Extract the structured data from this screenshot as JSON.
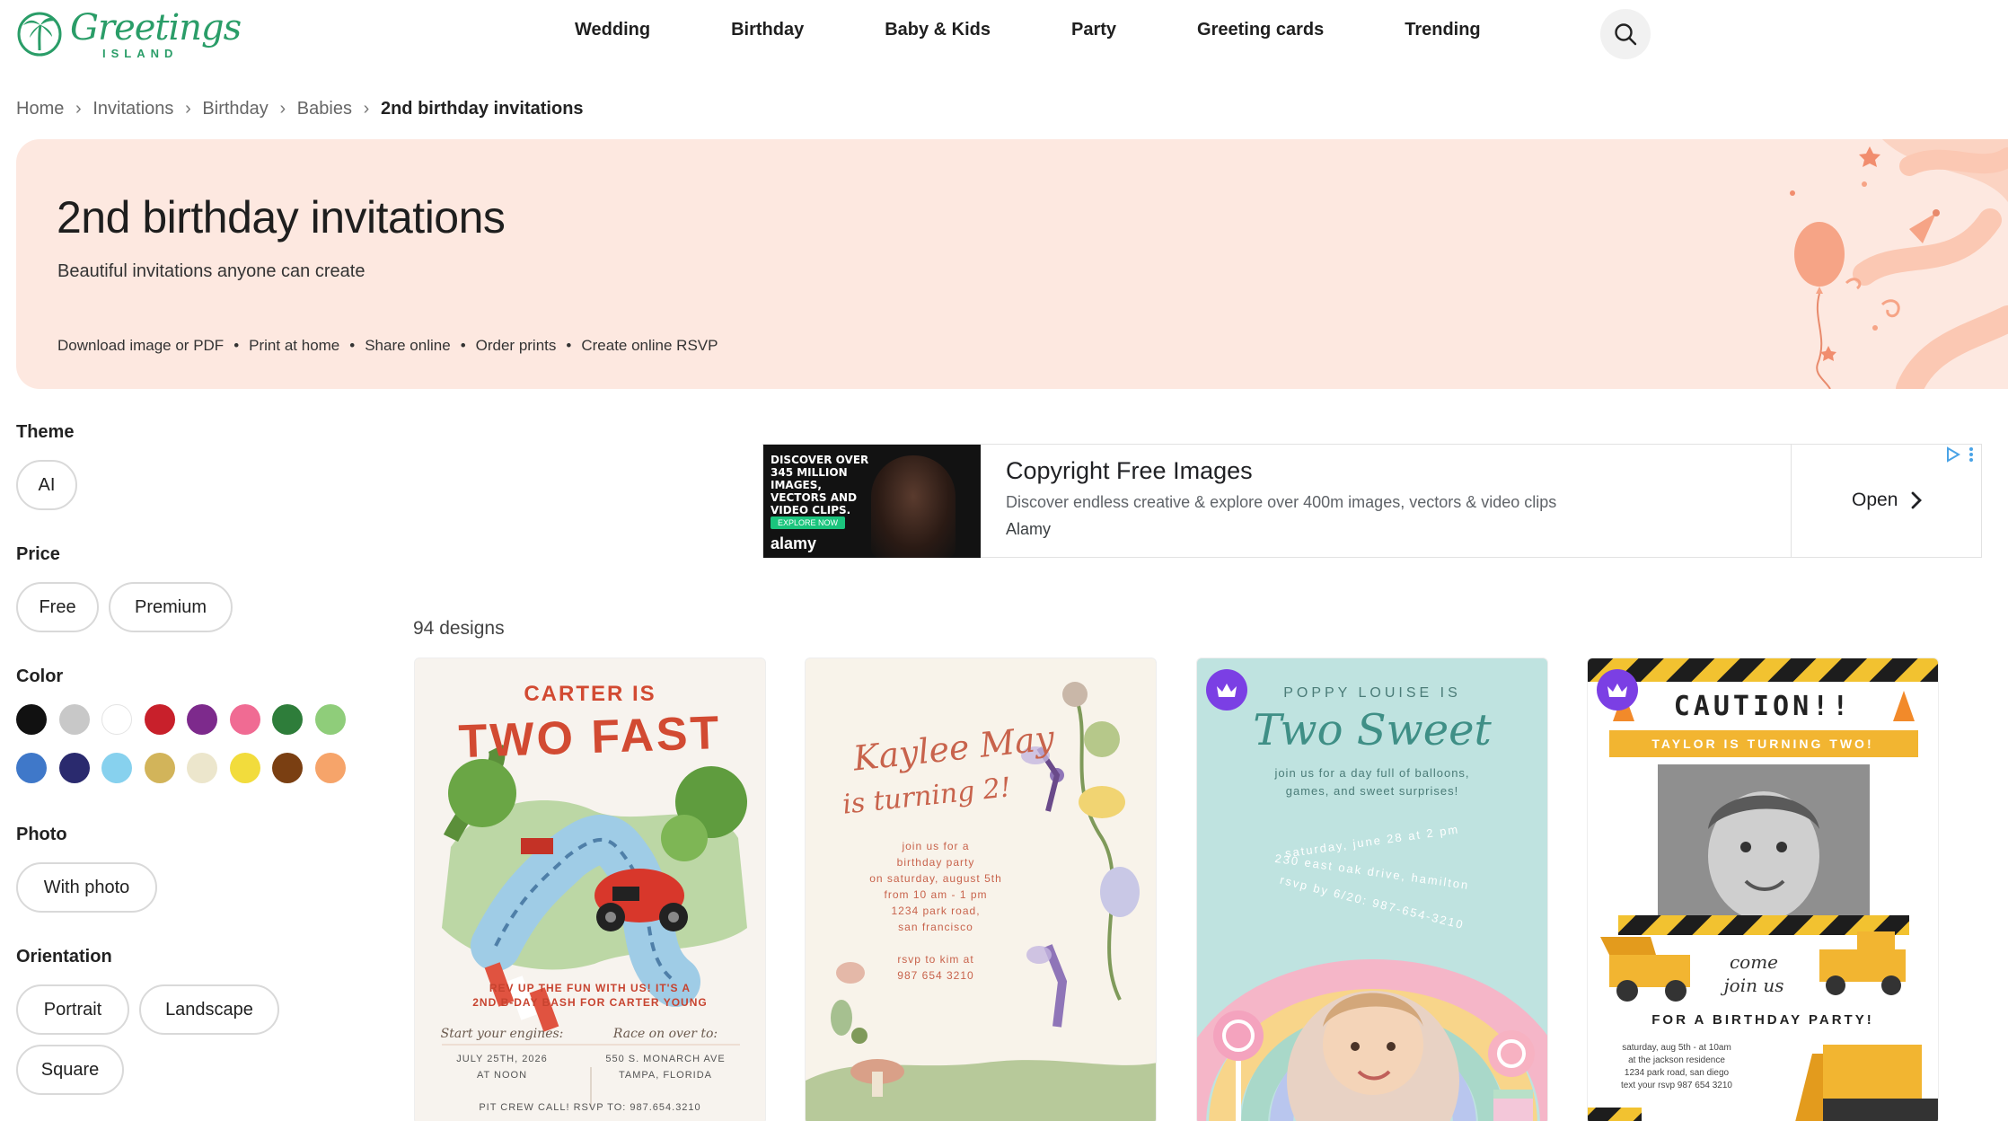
{
  "header": {
    "logo_word": "Greetings",
    "logo_sub": "ISLAND",
    "nav": [
      "Wedding",
      "Birthday",
      "Baby & Kids",
      "Party",
      "Greeting cards",
      "Trending"
    ]
  },
  "breadcrumb": [
    "Home",
    "Invitations",
    "Birthday",
    "Babies",
    "2nd birthday invitations"
  ],
  "hero": {
    "title": "2nd birthday invitations",
    "subtitle": "Beautiful invitations anyone can create",
    "features": [
      "Download image or PDF",
      "Print at home",
      "Share online",
      "Order prints",
      "Create online RSVP"
    ]
  },
  "filters": {
    "theme": {
      "label": "Theme",
      "options": [
        "AI"
      ]
    },
    "price": {
      "label": "Price",
      "options": [
        "Free",
        "Premium"
      ]
    },
    "color": {
      "label": "Color",
      "swatches": [
        "#111111",
        "#c8c8c8",
        "#ffffff",
        "#c8202b",
        "#7d2a8c",
        "#f06b93",
        "#2e7d3a",
        "#8fcd7a",
        "#3f78c9",
        "#2a2a6e",
        "#87d1ee",
        "#d2b45a",
        "#ece6cc",
        "#f2dc3c",
        "#7a3f12",
        "#f6a46a"
      ]
    },
    "photo": {
      "label": "Photo",
      "options": [
        "With photo"
      ]
    },
    "orientation": {
      "label": "Orientation",
      "options": [
        "Portrait",
        "Landscape",
        "Square"
      ]
    }
  },
  "ad": {
    "image_text": "DISCOVER OVER 345 MILLION IMAGES, VECTORS AND VIDEO CLIPS.",
    "image_cta": "EXPLORE NOW",
    "image_brand": "alamy",
    "title": "Copyright Free Images",
    "description": "Discover endless creative & explore over 400m images, vectors & video clips",
    "brand": "Alamy",
    "open_label": "Open"
  },
  "results": {
    "count_label": "94 designs",
    "cards": [
      {
        "premium": false,
        "heading_small": "CARTER IS",
        "heading_big": "TWO FAST",
        "line1": "REV UP THE FUN WITH US! IT'S A",
        "line2": "2ND B-DAY BASH FOR CARTER YOUNG",
        "left_script": "Start your engines:",
        "left_date": "JULY 25TH, 2026",
        "left_time": "AT NOON",
        "right_script": "Race on over to:",
        "right_addr": "550 S. MONARCH AVE",
        "right_city": "TAMPA, FLORIDA",
        "footer": "PIT CREW CALL! RSVP TO: 987.654.3210"
      },
      {
        "premium": false,
        "name": "Kaylee May",
        "subtitle": "is turning 2!",
        "details": [
          "join us for a",
          "birthday party",
          "on saturday, august 5th",
          "from 10 am - 1 pm",
          "1234 park road,",
          "san francisco"
        ],
        "rsvp": [
          "rsvp to kim at",
          "987 654 3210"
        ]
      },
      {
        "premium": true,
        "top": "POPPY LOUISE IS",
        "title": "Two Sweet",
        "sub1": "join us for a day full of balloons,",
        "sub2": "games, and sweet surprises!",
        "arc1": "saturday, june 28 at 2 pm",
        "arc2": "230 east oak drive, hamilton",
        "arc3": "rsvp by 6/20: 987-654-3210"
      },
      {
        "premium": true,
        "title": "CAUTION!!",
        "banner": "TAYLOR IS TURNING TWO!",
        "script1": "come",
        "script2": "join us",
        "cta": "FOR A BIRTHDAY PARTY!",
        "details": [
          "saturday, aug 5th - at 10am",
          "at the jackson residence",
          "1234 park road, san diego",
          "text your rsvp 987 654 3210"
        ]
      }
    ]
  }
}
